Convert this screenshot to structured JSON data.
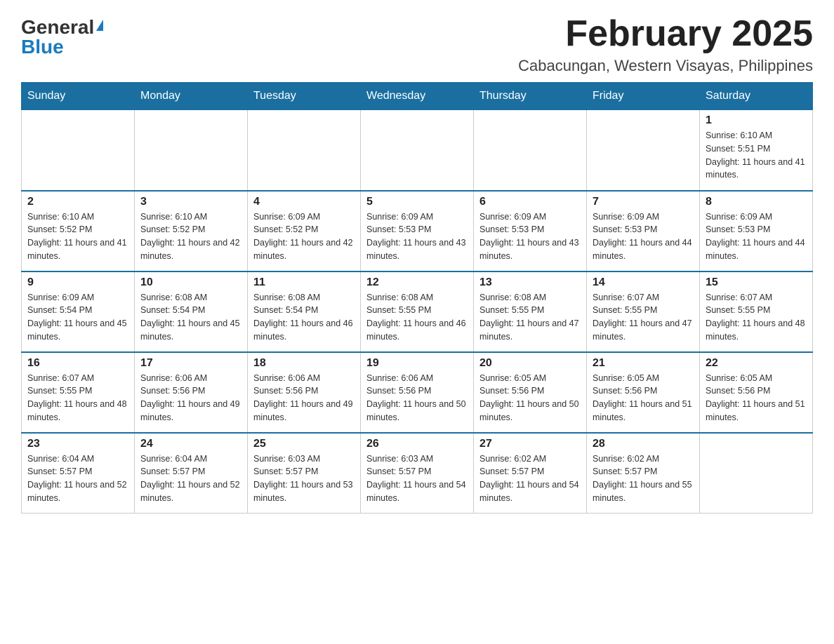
{
  "header": {
    "logo_general": "General",
    "logo_blue": "Blue",
    "month_title": "February 2025",
    "location": "Cabacungan, Western Visayas, Philippines"
  },
  "days_of_week": [
    "Sunday",
    "Monday",
    "Tuesday",
    "Wednesday",
    "Thursday",
    "Friday",
    "Saturday"
  ],
  "weeks": [
    [
      {
        "day": "",
        "info": ""
      },
      {
        "day": "",
        "info": ""
      },
      {
        "day": "",
        "info": ""
      },
      {
        "day": "",
        "info": ""
      },
      {
        "day": "",
        "info": ""
      },
      {
        "day": "",
        "info": ""
      },
      {
        "day": "1",
        "info": "Sunrise: 6:10 AM\nSunset: 5:51 PM\nDaylight: 11 hours and 41 minutes."
      }
    ],
    [
      {
        "day": "2",
        "info": "Sunrise: 6:10 AM\nSunset: 5:52 PM\nDaylight: 11 hours and 41 minutes."
      },
      {
        "day": "3",
        "info": "Sunrise: 6:10 AM\nSunset: 5:52 PM\nDaylight: 11 hours and 42 minutes."
      },
      {
        "day": "4",
        "info": "Sunrise: 6:09 AM\nSunset: 5:52 PM\nDaylight: 11 hours and 42 minutes."
      },
      {
        "day": "5",
        "info": "Sunrise: 6:09 AM\nSunset: 5:53 PM\nDaylight: 11 hours and 43 minutes."
      },
      {
        "day": "6",
        "info": "Sunrise: 6:09 AM\nSunset: 5:53 PM\nDaylight: 11 hours and 43 minutes."
      },
      {
        "day": "7",
        "info": "Sunrise: 6:09 AM\nSunset: 5:53 PM\nDaylight: 11 hours and 44 minutes."
      },
      {
        "day": "8",
        "info": "Sunrise: 6:09 AM\nSunset: 5:53 PM\nDaylight: 11 hours and 44 minutes."
      }
    ],
    [
      {
        "day": "9",
        "info": "Sunrise: 6:09 AM\nSunset: 5:54 PM\nDaylight: 11 hours and 45 minutes."
      },
      {
        "day": "10",
        "info": "Sunrise: 6:08 AM\nSunset: 5:54 PM\nDaylight: 11 hours and 45 minutes."
      },
      {
        "day": "11",
        "info": "Sunrise: 6:08 AM\nSunset: 5:54 PM\nDaylight: 11 hours and 46 minutes."
      },
      {
        "day": "12",
        "info": "Sunrise: 6:08 AM\nSunset: 5:55 PM\nDaylight: 11 hours and 46 minutes."
      },
      {
        "day": "13",
        "info": "Sunrise: 6:08 AM\nSunset: 5:55 PM\nDaylight: 11 hours and 47 minutes."
      },
      {
        "day": "14",
        "info": "Sunrise: 6:07 AM\nSunset: 5:55 PM\nDaylight: 11 hours and 47 minutes."
      },
      {
        "day": "15",
        "info": "Sunrise: 6:07 AM\nSunset: 5:55 PM\nDaylight: 11 hours and 48 minutes."
      }
    ],
    [
      {
        "day": "16",
        "info": "Sunrise: 6:07 AM\nSunset: 5:55 PM\nDaylight: 11 hours and 48 minutes."
      },
      {
        "day": "17",
        "info": "Sunrise: 6:06 AM\nSunset: 5:56 PM\nDaylight: 11 hours and 49 minutes."
      },
      {
        "day": "18",
        "info": "Sunrise: 6:06 AM\nSunset: 5:56 PM\nDaylight: 11 hours and 49 minutes."
      },
      {
        "day": "19",
        "info": "Sunrise: 6:06 AM\nSunset: 5:56 PM\nDaylight: 11 hours and 50 minutes."
      },
      {
        "day": "20",
        "info": "Sunrise: 6:05 AM\nSunset: 5:56 PM\nDaylight: 11 hours and 50 minutes."
      },
      {
        "day": "21",
        "info": "Sunrise: 6:05 AM\nSunset: 5:56 PM\nDaylight: 11 hours and 51 minutes."
      },
      {
        "day": "22",
        "info": "Sunrise: 6:05 AM\nSunset: 5:56 PM\nDaylight: 11 hours and 51 minutes."
      }
    ],
    [
      {
        "day": "23",
        "info": "Sunrise: 6:04 AM\nSunset: 5:57 PM\nDaylight: 11 hours and 52 minutes."
      },
      {
        "day": "24",
        "info": "Sunrise: 6:04 AM\nSunset: 5:57 PM\nDaylight: 11 hours and 52 minutes."
      },
      {
        "day": "25",
        "info": "Sunrise: 6:03 AM\nSunset: 5:57 PM\nDaylight: 11 hours and 53 minutes."
      },
      {
        "day": "26",
        "info": "Sunrise: 6:03 AM\nSunset: 5:57 PM\nDaylight: 11 hours and 54 minutes."
      },
      {
        "day": "27",
        "info": "Sunrise: 6:02 AM\nSunset: 5:57 PM\nDaylight: 11 hours and 54 minutes."
      },
      {
        "day": "28",
        "info": "Sunrise: 6:02 AM\nSunset: 5:57 PM\nDaylight: 11 hours and 55 minutes."
      },
      {
        "day": "",
        "info": ""
      }
    ]
  ]
}
